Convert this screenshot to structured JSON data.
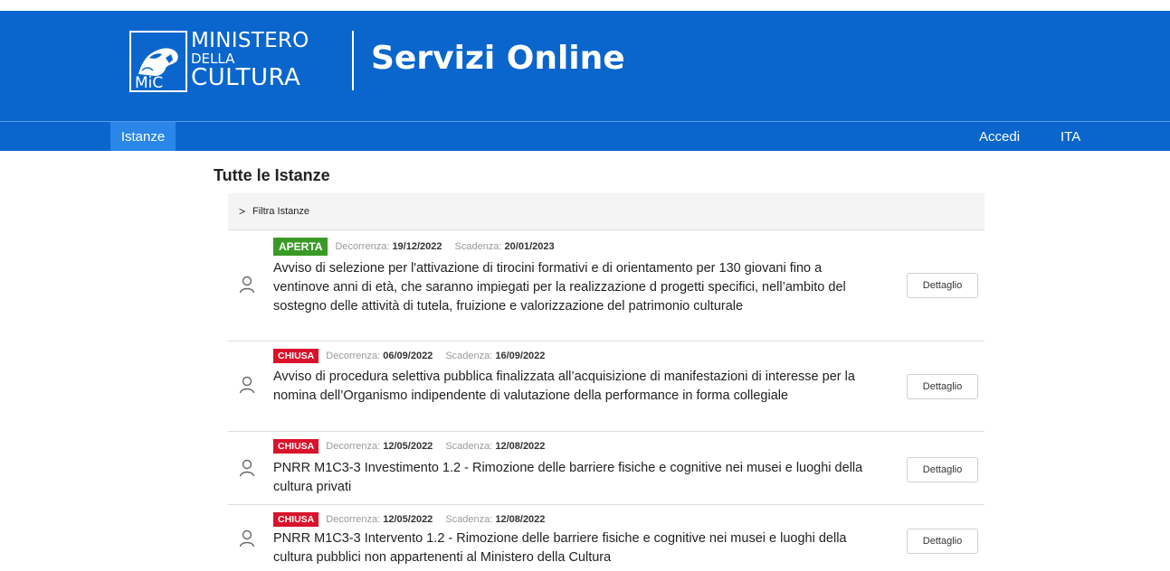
{
  "header": {
    "logo": {
      "line1": "MINISTERO",
      "line2": "DELLA",
      "line3": "CULTURA",
      "mark": "MiC"
    },
    "site_title": "Servizi Online"
  },
  "nav": {
    "active_tab": "Istanze",
    "login": "Accedi",
    "language": "ITA"
  },
  "page_title": "Tutte le Istanze",
  "filter": {
    "label": "Filtra Istanze",
    "icon": "chevron-right-icon"
  },
  "labels": {
    "decorrenza": "Decorrenza:",
    "scadenza": "Scadenza:"
  },
  "items": [
    {
      "status": "APERTA",
      "status_color": "#3a9a26",
      "decorrenza": "19/12/2022",
      "scadenza": "20/01/2023",
      "title": "Avviso di selezione per l'attivazione di tirocini formativi e di orientamento per 130 giovani fino a ventinove anni di età, che saranno impiegati per la realizzazione d progetti specifici, nell’ambito del sostegno delle attività di tutela, fruizione e valorizzazione del patrimonio culturale",
      "button": "Dettaglio"
    },
    {
      "status": "CHIUSA",
      "status_color": "#d8132b",
      "decorrenza": "06/09/2022",
      "scadenza": "16/09/2022",
      "title": "Avviso di procedura selettiva pubblica finalizzata all’acquisizione di manifestazioni di interesse per la nomina dell’Organismo indipendente di valutazione della performance in forma collegiale",
      "button": "Dettaglio"
    },
    {
      "status": "CHIUSA",
      "status_color": "#d8132b",
      "decorrenza": "12/05/2022",
      "scadenza": "12/08/2022",
      "title": "PNRR M1C3-3 Investimento 1.2 - Rimozione delle barriere fisiche e cognitive nei musei e luoghi della cultura privati",
      "button": "Dettaglio"
    },
    {
      "status": "CHIUSA",
      "status_color": "#d8132b",
      "decorrenza": "12/05/2022",
      "scadenza": "12/08/2022",
      "title": "PNRR M1C3-3 Intervento 1.2 - Rimozione delle barriere fisiche e cognitive nei musei e luoghi della cultura pubblici non appartenenti al Ministero della Cultura",
      "button": "Dettaglio"
    }
  ],
  "colors": {
    "brand_blue": "#0a66cc",
    "active_tab": "#2a86e8"
  }
}
